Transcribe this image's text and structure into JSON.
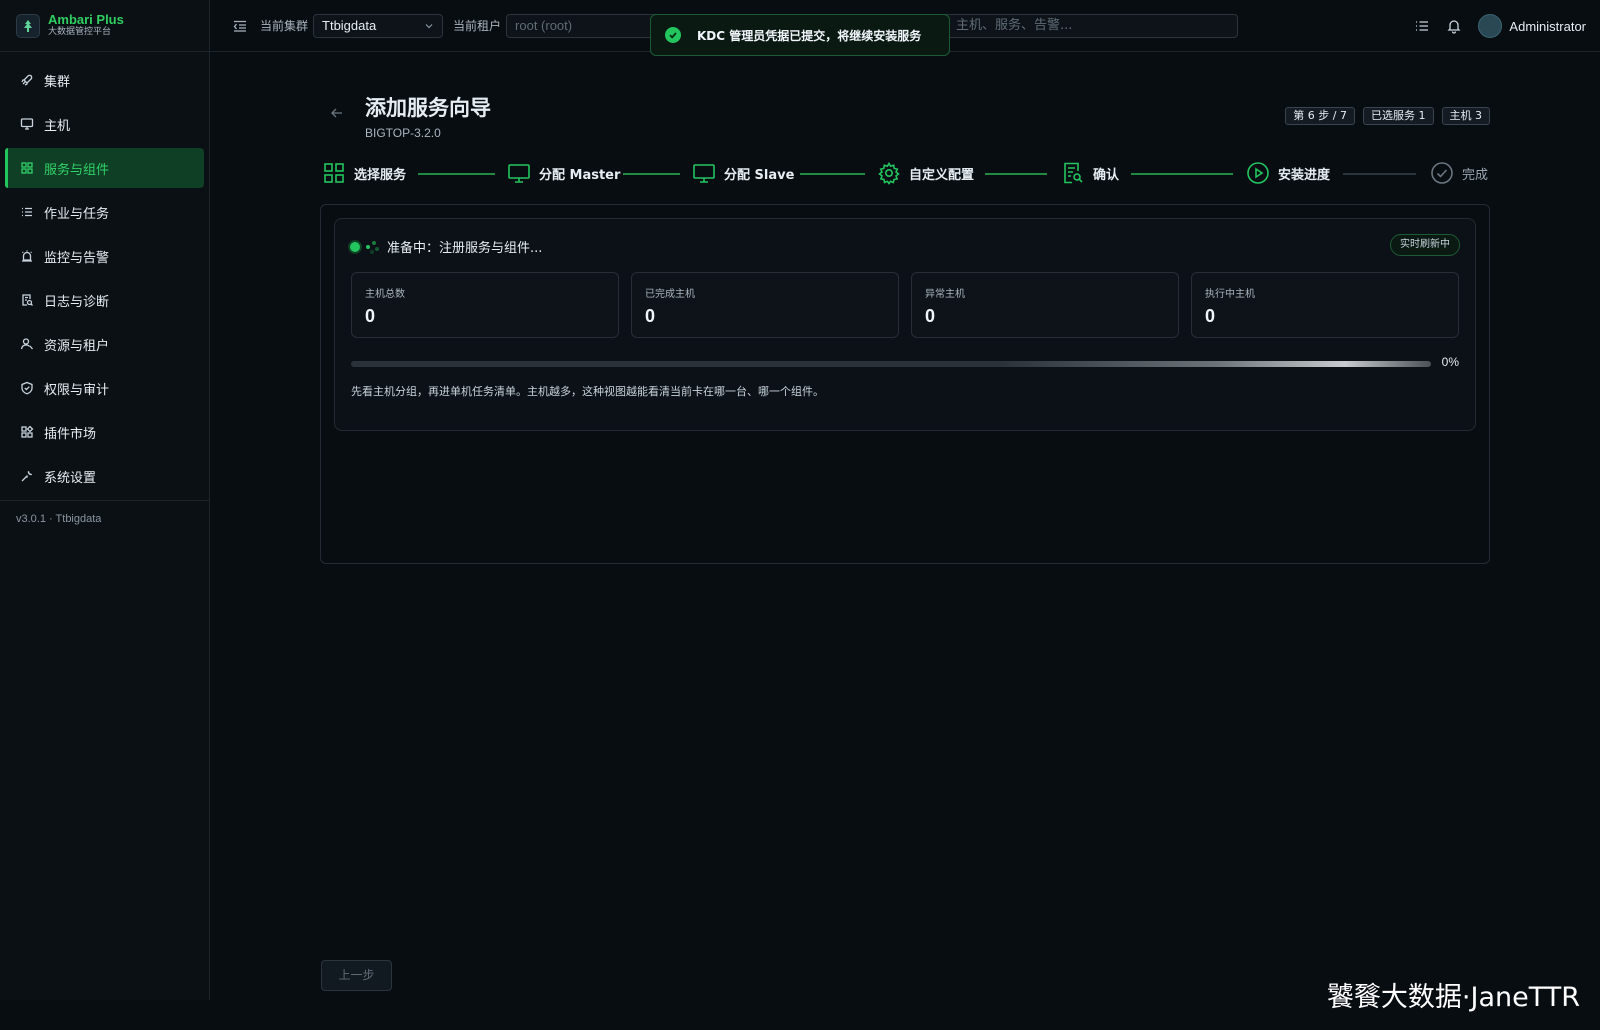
{
  "brand": {
    "name": "Ambari Plus",
    "subtitle": "大数据管控平台"
  },
  "sidebar": {
    "items": [
      {
        "label": "集群",
        "icon": "rocket-icon",
        "active": false
      },
      {
        "label": "主机",
        "icon": "monitor-icon",
        "active": false
      },
      {
        "label": "服务与组件",
        "icon": "grid-icon",
        "active": true
      },
      {
        "label": "作业与任务",
        "icon": "list-icon",
        "active": false
      },
      {
        "label": "监控与告警",
        "icon": "alarm-icon",
        "active": false
      },
      {
        "label": "日志与诊断",
        "icon": "log-search-icon",
        "active": false
      },
      {
        "label": "资源与租户",
        "icon": "users-icon",
        "active": false
      },
      {
        "label": "权限与审计",
        "icon": "shield-check-icon",
        "active": false
      },
      {
        "label": "插件市场",
        "icon": "apps-icon",
        "active": false
      },
      {
        "label": "系统设置",
        "icon": "wrench-icon",
        "active": false
      }
    ],
    "footer": "v3.0.1 · Ttbigdata"
  },
  "topbar": {
    "cluster_label": "当前集群",
    "cluster_value": "Ttbigdata",
    "tenant_label": "当前租户",
    "tenant_placeholder": "root (root)",
    "search_placeholder": "主机、服务、告警...",
    "user_name": "Administrator"
  },
  "toast": {
    "text": "KDC 管理员凭据已提交，将继续安装服务",
    "icon": "check-circle-icon"
  },
  "page": {
    "title": "添加服务向导",
    "subtitle": "BIGTOP-3.2.0",
    "badges": [
      "第 6 步 / 7",
      "已选服务 1",
      "主机 3"
    ]
  },
  "steps": [
    {
      "label": "选择服务",
      "icon": "grid-icon",
      "state": "done"
    },
    {
      "label": "分配 Master",
      "icon": "monitor-icon",
      "state": "done"
    },
    {
      "label": "分配 Slave",
      "icon": "monitor-icon",
      "state": "done"
    },
    {
      "label": "自定义配置",
      "icon": "gear-icon",
      "state": "done"
    },
    {
      "label": "确认",
      "icon": "doc-search-icon",
      "state": "done"
    },
    {
      "label": "安装进度",
      "icon": "play-circle-icon",
      "state": "current"
    },
    {
      "label": "完成",
      "icon": "check-circle-icon",
      "state": "pending"
    }
  ],
  "progress": {
    "status_text": "准备中：注册服务与组件...",
    "live_label": "实时刷新中",
    "stats": [
      {
        "label": "主机总数",
        "value": "0"
      },
      {
        "label": "已完成主机",
        "value": "0"
      },
      {
        "label": "异常主机",
        "value": "0"
      },
      {
        "label": "执行中主机",
        "value": "0"
      }
    ],
    "percent": 0,
    "percent_label": "0%",
    "hint": "先看主机分组，再进单机任务清单。主机越多，这种视图越能看清当前卡在哪一台、哪一个组件。"
  },
  "footer": {
    "prev_label": "上一步"
  },
  "watermark": "饕餮大数据·JaneTTR",
  "colors": {
    "accent": "#22c55e",
    "background": "#080d12"
  }
}
